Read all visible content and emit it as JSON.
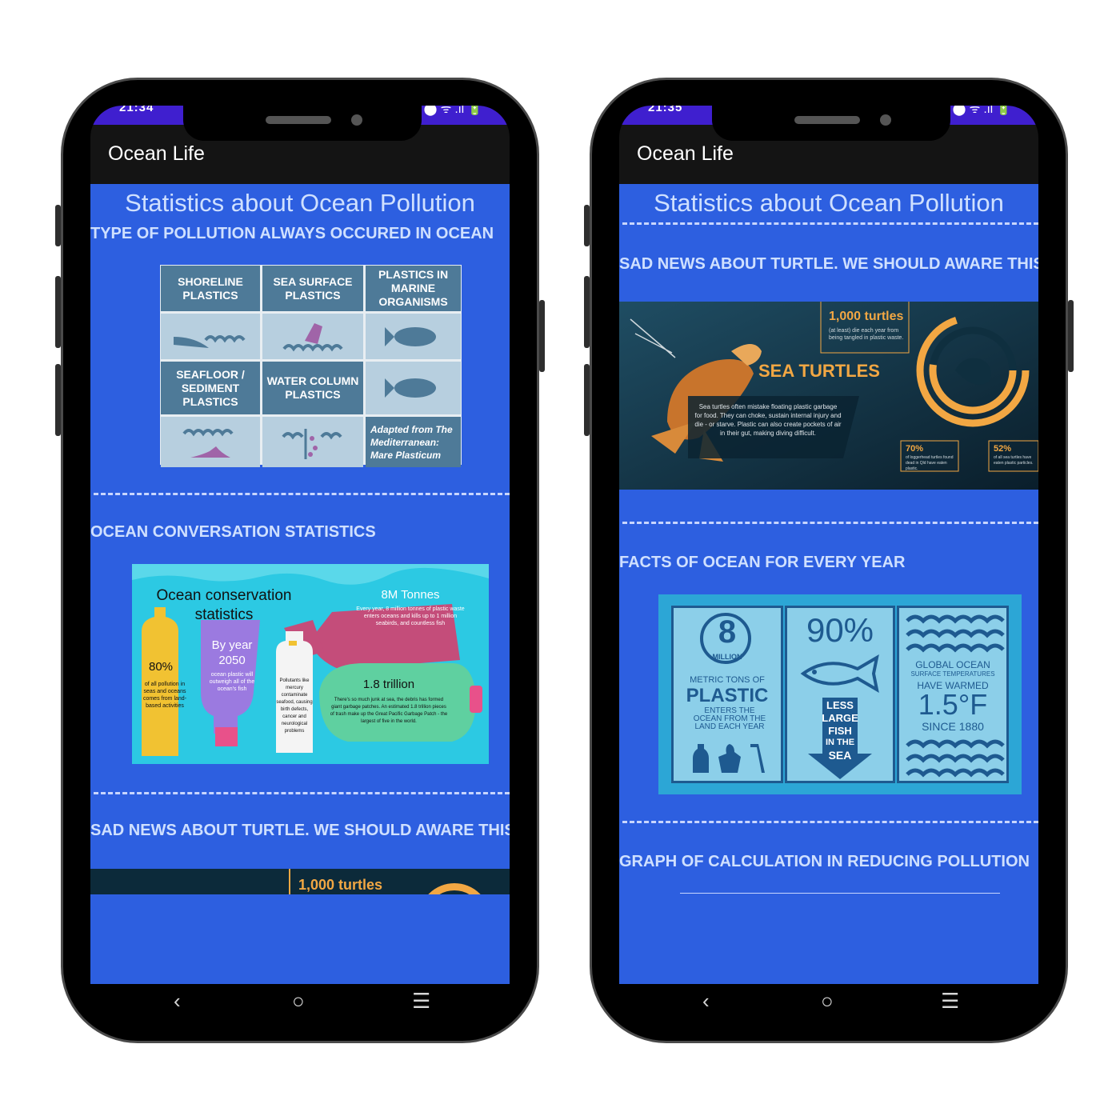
{
  "left_phone": {
    "status": {
      "time": "21:34",
      "icons": "⬤ ᯤ .ıl 🔋"
    },
    "app_title": "Ocean Life",
    "screen_title": "Statistics about Ocean Pollution",
    "section1_heading": "TYPE OF POLLUTION ALWAYS OCCURED IN OCEAN",
    "pollution_grid": {
      "shoreline": "SHORELINE PLASTICS",
      "sea_surface": "SEA SURFACE PLASTICS",
      "marine_organisms": "PLASTICS IN MARINE ORGANISMS",
      "seafloor": "SEAFLOOR / SEDIMENT PLASTICS",
      "water_column": "WATER COLUMN PLASTICS",
      "adapted": "Adapted from The Mediterranean: Mare Plasticum"
    },
    "divider1": "",
    "section2_heading": "OCEAN CONVERSATION STATISTICS",
    "conservation": {
      "title": "Ocean conservation statistics",
      "tonnes_head": "8M Tonnes",
      "tonnes_body": "Every year, 8 million tonnes of plastic waste enters oceans and kills up to 1 million seabirds, and countless fish",
      "pct_head": "80%",
      "pct_body": "of all pollution in seas and oceans comes from land-based activities",
      "year_head": "By year 2050",
      "year_body": "ocean plastic will outweigh all of the ocean's fish",
      "pollutants_body": "Pollutants like mercury contaminate seafood, causing birth defects, cancer and neurological problems",
      "trillion_head": "1.8 trillion",
      "trillion_body": "There's so much junk at sea, the debris has formed giant garbage patches. An estimated 1.8 trillion pieces of trash make up the Great Pacific Garbage Patch - the largest of five in the world."
    },
    "section3_heading": "SAD NEWS ABOUT TURTLE. WE SHOULD AWARE THIS",
    "turtle_peek": "1,000 turtles"
  },
  "right_phone": {
    "status": {
      "time": "21:35",
      "icons": "⬤ ᯤ .ıl 🔋"
    },
    "app_title": "Ocean Life",
    "screen_title": "Statistics about Ocean Pollution",
    "section1_heading": "SAD NEWS ABOUT TURTLE. WE SHOULD AWARE THIS",
    "turtles": {
      "count_head": "1,000 turtles",
      "count_body": "(at least) die each year from being tangled in plastic waste.",
      "title": "SEA TURTLES",
      "body": "Sea turtles often mistake floating plastic garbage for food. They can choke, sustain internal injury and die - or starve. Plastic can also create pockets of air in their gut, making diving difficult.",
      "stat1_head": "70%",
      "stat1_body": "of loggerhead turtles found dead in Qld have eaten plastic.",
      "stat2_head": "52%",
      "stat2_body": "of all sea turtles have eaten plastic particles."
    },
    "section2_heading": "FACTS OF OCEAN FOR EVERY YEAR",
    "facts": {
      "million_num": "8",
      "million_word": "MILLION",
      "metric": "METRIC TONS OF",
      "plastic": "PLASTIC",
      "enters": "ENTERS THE OCEAN FROM THE LAND EACH YEAR",
      "pct": "90%",
      "less1": "LESS",
      "less2": "LARGE",
      "less3": "FISH",
      "less4": "IN THE",
      "less5": "SEA",
      "global": "GLOBAL OCEAN",
      "surface": "SURFACE TEMPERATURES",
      "warmed": "HAVE WARMED",
      "degrees": "1.5°F",
      "since": "SINCE 1880"
    },
    "section3_heading": "GRAPH OF CALCULATION IN REDUCING POLLUTION"
  },
  "nav": {
    "back": "‹",
    "home": "○",
    "menu": "☰"
  },
  "colors": {
    "content_bg": "#2d5fe0",
    "status_bar": "#3f1fcf",
    "app_bar": "#141414",
    "heading_text": "#cfe0ff"
  }
}
